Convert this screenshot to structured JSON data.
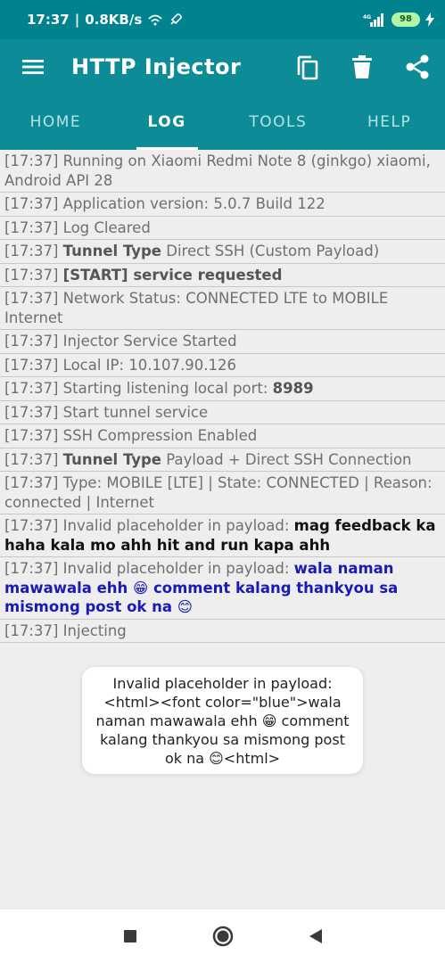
{
  "status": {
    "time": "17:37",
    "speed": "0.8KB/s",
    "network": "4G",
    "battery": "98"
  },
  "appbar": {
    "title": "HTTP Injector",
    "menu_icon": "hamburger-menu-icon",
    "actions": [
      "copy-icon",
      "delete-icon",
      "share-icon"
    ]
  },
  "tabs": [
    {
      "label": "HOME"
    },
    {
      "label": "LOG"
    },
    {
      "label": "TOOLS"
    },
    {
      "label": "HELP"
    }
  ],
  "log": [
    {
      "prefix": "[17:37] Running on Xiaomi Redmi Note 8 (ginkgo) xiaomi, Android API 28"
    },
    {
      "prefix": "[17:37] Application version: 5.0.7 Build 122"
    },
    {
      "prefix": "[17:37] Log Cleared"
    },
    {
      "prefix": "[17:37] ",
      "bold": "Tunnel Type",
      "suffix": " Direct SSH (Custom Payload)"
    },
    {
      "prefix": "[17:37] ",
      "bold": "[START] service requested"
    },
    {
      "prefix": "[17:37] Network Status: CONNECTED LTE to MOBILE Internet"
    },
    {
      "prefix": "[17:37] Injector Service Started"
    },
    {
      "prefix": "[17:37] Local IP: 10.107.90.126"
    },
    {
      "prefix": "[17:37] Starting listening local port: ",
      "bold": "8989"
    },
    {
      "prefix": "[17:37] Start tunnel service"
    },
    {
      "prefix": "[17:37] SSH Compression Enabled"
    },
    {
      "prefix": "[17:37] ",
      "bold": "Tunnel Type",
      "suffix": " Payload + Direct SSH Connection"
    },
    {
      "prefix": "[17:37] Type: MOBILE [LTE] | State: CONNECTED | Reason: connected | Internet"
    },
    {
      "prefix": "[17:37] Invalid placeholder in payload: ",
      "black": "mag feedback ka haha kala mo ahh hit and run kapa ahh"
    },
    {
      "prefix": "[17:37] Invalid placeholder in payload: ",
      "blue": "wala naman mawawala ehh 😁 comment kalang thankyou sa mismong post ok na 😊"
    },
    {
      "prefix": "[17:37] Injecting"
    }
  ],
  "toast": {
    "text": "Invalid placeholder in payload: <html><font color=\"blue\">wala naman mawawala ehh 😁 comment kalang thankyou sa mismong post ok na 😊<html>"
  },
  "navbar": [
    "recents-square-icon",
    "home-circle-icon",
    "back-triangle-icon"
  ]
}
